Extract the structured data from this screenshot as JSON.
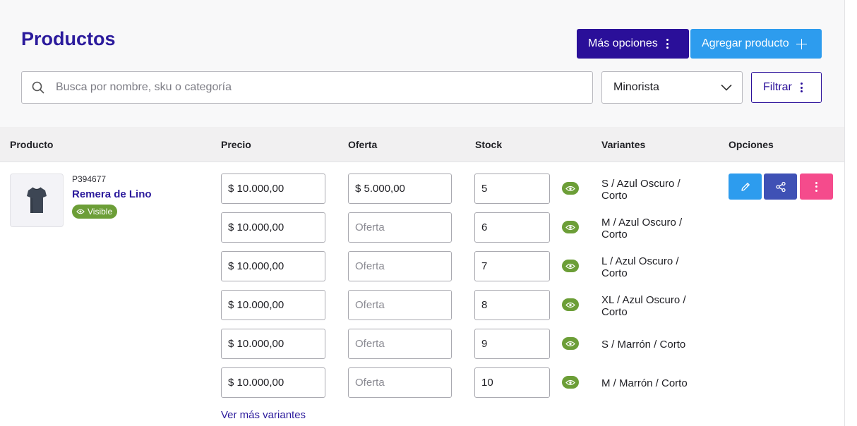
{
  "header": {
    "title": "Productos",
    "more_options_label": "Más opciones",
    "add_product_label": "Agregar producto"
  },
  "filters": {
    "search_placeholder": "Busca por nombre, sku o categoría",
    "price_list_selected": "Minorista",
    "filter_label": "Filtrar"
  },
  "table": {
    "columns": [
      "Producto",
      "Precio",
      "Oferta",
      "Stock",
      "Variantes",
      "Opciones"
    ]
  },
  "product": {
    "sku": "P394677",
    "name": "Remera de Lino",
    "status": "Visible",
    "variants": [
      {
        "price": "$ 10.000,00",
        "offer": "$ 5.000,00",
        "stock": "5",
        "label": "S / Azul Oscuro / Corto"
      },
      {
        "price": "$ 10.000,00",
        "offer": "",
        "stock": "6",
        "label": "M / Azul Oscuro / Corto"
      },
      {
        "price": "$ 10.000,00",
        "offer": "",
        "stock": "7",
        "label": "L / Azul Oscuro / Corto"
      },
      {
        "price": "$ 10.000,00",
        "offer": "",
        "stock": "8",
        "label": "XL / Azul Oscuro / Corto"
      },
      {
        "price": "$ 10.000,00",
        "offer": "",
        "stock": "9",
        "label": "S / Marrón / Corto"
      },
      {
        "price": "$ 10.000,00",
        "offer": "",
        "stock": "10",
        "label": "M / Marrón / Corto"
      }
    ],
    "offer_placeholder": "Oferta",
    "see_more_variants": "Ver más variantes",
    "actions": [
      "edit-icon",
      "share-icon",
      "more-vertical-icon"
    ]
  },
  "icons": {
    "search": "search-icon",
    "dropdown": "chevron-down-icon",
    "add": "plus-icon",
    "visibility": "eye-icon"
  },
  "colors": {
    "brand": "#2a0f99",
    "primary_blue": "#2d9cee",
    "visible_green": "#6c9e37",
    "share_indigo": "#3f51b5",
    "more_pink": "#f54b8c"
  }
}
